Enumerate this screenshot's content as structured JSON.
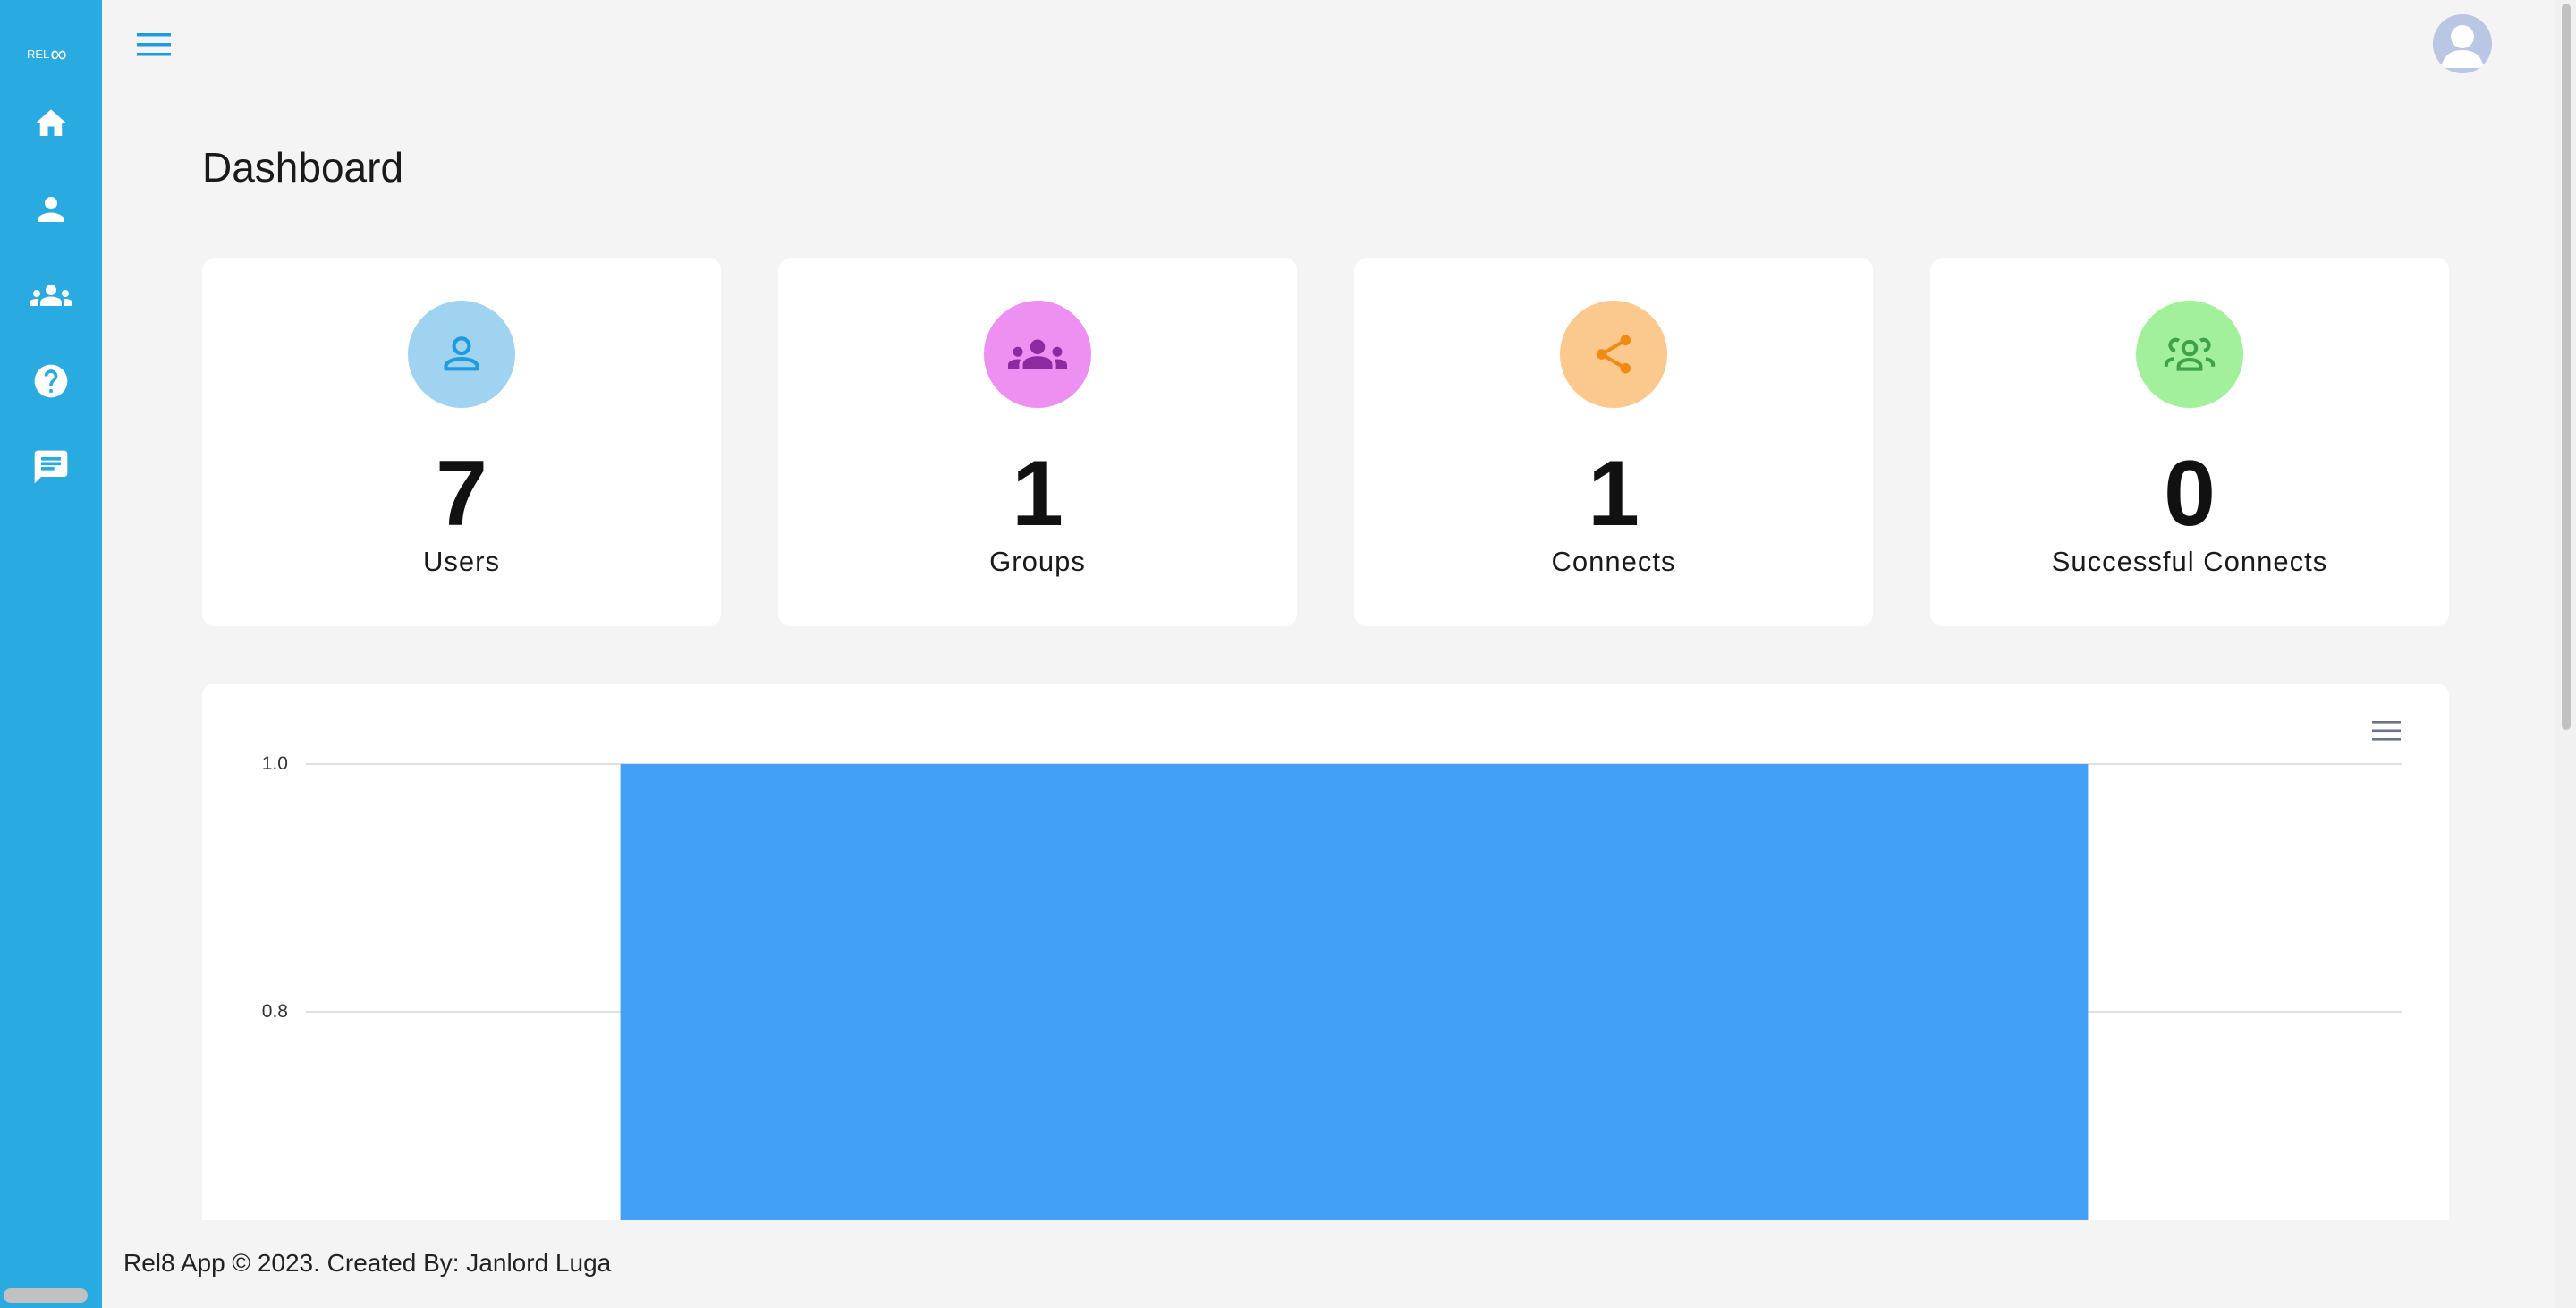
{
  "app": {
    "logo_text": "REL",
    "logo_mark": "∞"
  },
  "sidebar": {
    "items": [
      {
        "name": "home",
        "icon": "home-icon"
      },
      {
        "name": "users",
        "icon": "person-icon"
      },
      {
        "name": "groups",
        "icon": "groups-icon"
      },
      {
        "name": "help",
        "icon": "help-icon"
      },
      {
        "name": "messages",
        "icon": "chat-icon"
      }
    ]
  },
  "header": {
    "menu_icon": "hamburger-icon",
    "avatar_icon": "avatar-icon"
  },
  "page": {
    "title": "Dashboard"
  },
  "stats": [
    {
      "count": "7",
      "label": "Users",
      "icon": "person-outline-icon",
      "circle_color": "#9fd3f0",
      "icon_color": "#1e9be0"
    },
    {
      "count": "1",
      "label": "Groups",
      "icon": "groups-icon",
      "circle_color": "#ee8ff2",
      "icon_color": "#8e2a9f"
    },
    {
      "count": "1",
      "label": "Connects",
      "icon": "share-icon",
      "circle_color": "#fbc98d",
      "icon_color": "#f08a12"
    },
    {
      "count": "0",
      "label": "Successful Connects",
      "icon": "group-outline-icon",
      "circle_color": "#a2f09b",
      "icon_color": "#3da24a"
    }
  ],
  "chart_data": {
    "type": "bar",
    "categories": [
      ""
    ],
    "values": [
      1
    ],
    "yticks": [
      "1.0",
      "0.8"
    ],
    "ylim_visible": [
      0.8,
      1.0
    ],
    "bar_color": "#42a0f7",
    "grid": true,
    "menu_icon": "chart-menu-icon"
  },
  "footer": {
    "text": "Rel8 App © 2023. Created By: Janlord Luga"
  },
  "colors": {
    "sidebar": "#29abe2",
    "accent": "#1e9be0",
    "background": "#f4f4f4"
  }
}
